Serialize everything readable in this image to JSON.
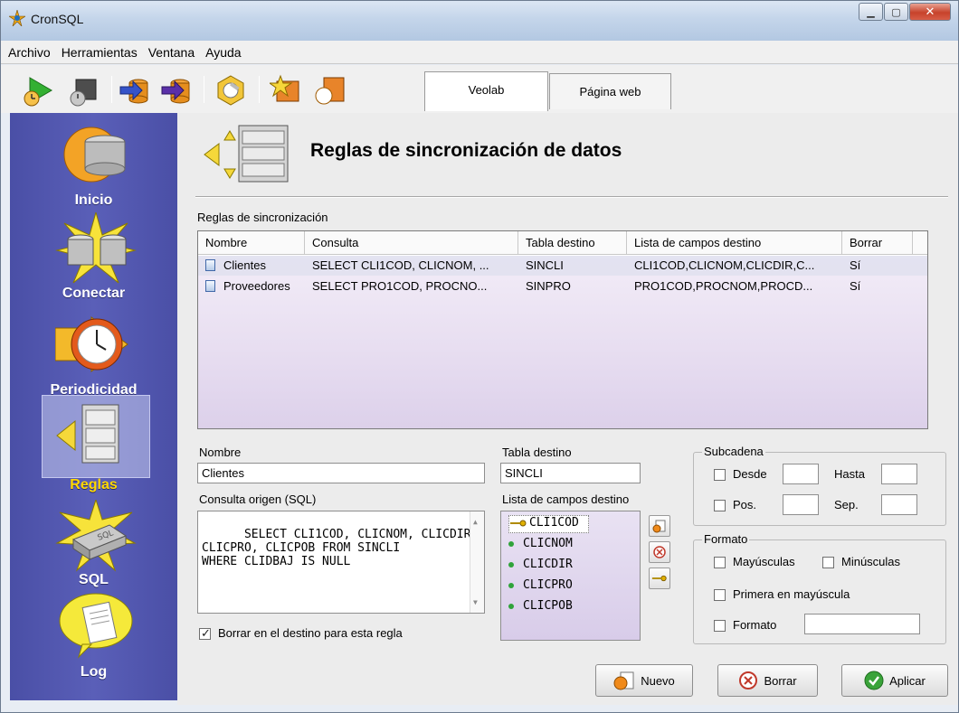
{
  "window": {
    "title": "CronSQL"
  },
  "menu": [
    "Archivo",
    "Herramientas",
    "Ventana",
    "Ayuda"
  ],
  "tabs": [
    {
      "label": "Veolab",
      "active": true
    },
    {
      "label": "Página web",
      "active": false
    }
  ],
  "sidebar": {
    "items": [
      {
        "label": "Inicio",
        "icon": "database-sun-icon"
      },
      {
        "label": "Conectar",
        "icon": "database-connect-icon"
      },
      {
        "label": "Periodicidad",
        "icon": "clock-icon"
      },
      {
        "label": "Reglas",
        "icon": "file-cabinet-icon",
        "active": true
      },
      {
        "label": "SQL",
        "icon": "sql-key-icon"
      },
      {
        "label": "Log",
        "icon": "log-document-icon"
      }
    ]
  },
  "header": {
    "title": "Reglas de sincronización de datos"
  },
  "rules": {
    "label": "Reglas de sincronización",
    "columns": [
      "Nombre",
      "Consulta",
      "Tabla destino",
      "Lista de campos destino",
      "Borrar"
    ],
    "rows": [
      [
        "Clientes",
        "SELECT CLI1COD, CLICNOM, ...",
        "SINCLI",
        "CLI1COD,CLICNOM,CLICDIR,C...",
        "Sí"
      ],
      [
        "Proveedores",
        "SELECT PRO1COD, PROCNO...",
        "SINPRO",
        "PRO1COD,PROCNOM,PROCD...",
        "Sí"
      ]
    ]
  },
  "form": {
    "nombre_label": "Nombre",
    "nombre_value": "Clientes",
    "tabla_label": "Tabla destino",
    "tabla_value": "SINCLI",
    "consulta_label": "Consulta origen (SQL)",
    "consulta_value": "SELECT CLI1COD, CLICNOM, CLICDIR,\nCLICPRO, CLICPOB FROM SINCLI\nWHERE CLIDBAJ IS NULL",
    "campos_label": "Lista de campos destino",
    "campos": [
      {
        "name": "CLI1COD",
        "key": true
      },
      {
        "name": "CLICNOM",
        "key": false
      },
      {
        "name": "CLICDIR",
        "key": false
      },
      {
        "name": "CLICPRO",
        "key": false
      },
      {
        "name": "CLICPOB",
        "key": false
      }
    ],
    "borrar_label": "Borrar en el destino para esta regla",
    "borrar_checked": true
  },
  "subcadena": {
    "title": "Subcadena",
    "desde_label": "Desde",
    "hasta_label": "Hasta",
    "pos_label": "Pos.",
    "sep_label": "Sep."
  },
  "formato": {
    "title": "Formato",
    "mayusculas_label": "Mayúsculas",
    "minusculas_label": "Minúsculas",
    "primera_label": "Primera en mayúscula",
    "formato_label": "Formato"
  },
  "buttons": {
    "nuevo": "Nuevo",
    "borrar": "Borrar",
    "aplicar": "Aplicar"
  },
  "colors": {
    "sidebar": "#4f54ad",
    "active_label": "#ffd800",
    "grid_watermark": "#e6dcf0"
  }
}
